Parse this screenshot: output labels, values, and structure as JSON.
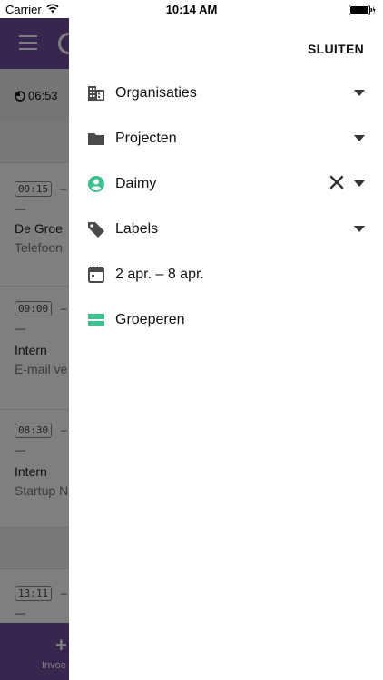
{
  "status_bar": {
    "carrier": "Carrier",
    "time": "10:14 AM"
  },
  "app": {
    "timer": "06:53",
    "entries": [
      {
        "time": "09:15",
        "dash": "–",
        "dash2": "—",
        "title": "De Groe",
        "subtitle": "Telefoon"
      },
      {
        "time": "09:00",
        "dash": "–",
        "dash2": "—",
        "title": "Intern",
        "subtitle": "E-mail ve"
      },
      {
        "time": "08:30",
        "dash": "–",
        "dash2": "—",
        "title": "Intern",
        "subtitle": "Startup N"
      },
      {
        "time": "13:11",
        "dash": "–",
        "dash2": "—"
      }
    ],
    "add_label": "Invoe"
  },
  "drawer": {
    "close_label": "SLUITEN",
    "filters": [
      {
        "label": "Organisaties",
        "icon": "building-icon"
      },
      {
        "label": "Projecten",
        "icon": "folder-icon"
      },
      {
        "label": "Daimy",
        "icon": "user-icon"
      },
      {
        "label": "Labels",
        "icon": "tag-icon"
      },
      {
        "label": "2 apr. – 8 apr.",
        "icon": "calendar-icon"
      },
      {
        "label": "Groeperen",
        "icon": "group-icon"
      }
    ]
  },
  "colors": {
    "brand": "#6e4d9d",
    "accent_green": "#3cc08e"
  }
}
